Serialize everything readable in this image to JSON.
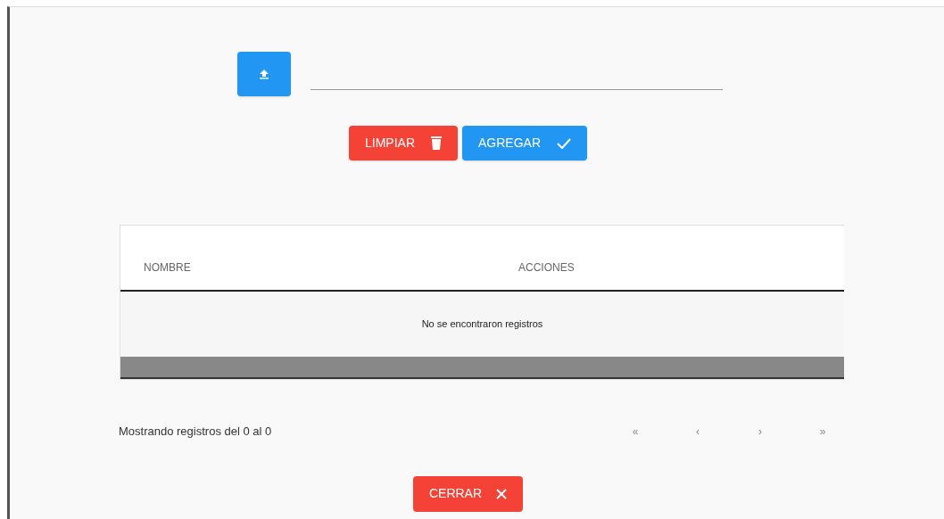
{
  "actions": [
    {
      "label": "LIMPIAR",
      "kind": "clear"
    },
    {
      "label": "AGREGAR",
      "kind": "add"
    }
  ],
  "table": {
    "columns": [
      "NOMBRE",
      "ACCIONES"
    ],
    "empty_message": "No se encontraron registros"
  },
  "footer": {
    "summary": "Mostrando registros del 0 al 0",
    "pager": [
      {
        "label": "«",
        "disabled": true
      },
      {
        "label": "‹",
        "disabled": true
      },
      {
        "label": "›",
        "disabled": true
      },
      {
        "label": "»",
        "disabled": true
      }
    ]
  },
  "close_button": {
    "label": "CERRAR"
  }
}
